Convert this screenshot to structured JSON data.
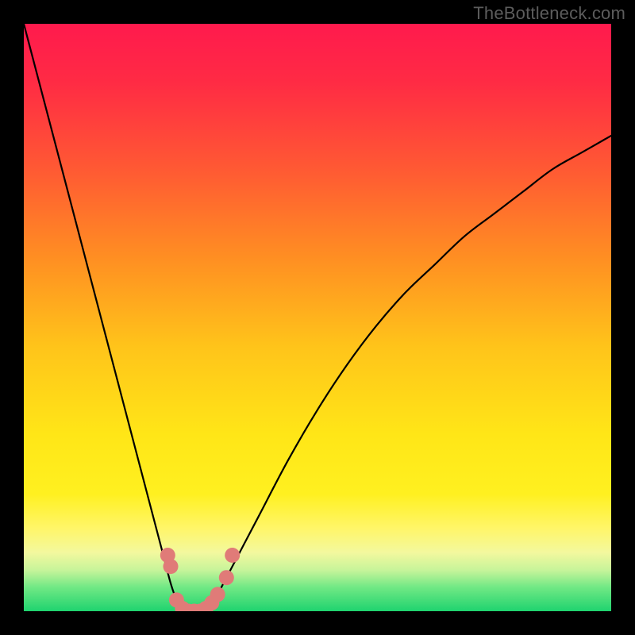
{
  "watermark": "TheBottleneck.com",
  "chart_data": {
    "type": "line",
    "title": "",
    "xlabel": "",
    "ylabel": "",
    "xlim": [
      0,
      100
    ],
    "ylim": [
      -5,
      100
    ],
    "series": [
      {
        "name": "bottleneck-curve",
        "x": [
          0,
          2,
          4,
          6,
          8,
          10,
          12,
          14,
          16,
          18,
          20,
          22,
          24,
          25,
          26,
          27,
          28,
          29,
          30,
          31,
          32,
          33,
          34,
          35,
          37,
          40,
          45,
          50,
          55,
          60,
          65,
          70,
          75,
          80,
          85,
          90,
          95,
          100
        ],
        "values": [
          100,
          92,
          84,
          76,
          68,
          60,
          52,
          44,
          36,
          28,
          20,
          12,
          4,
          0,
          -3,
          -5,
          -5,
          -5,
          -5,
          -5,
          -4,
          -2,
          0,
          2,
          6,
          12,
          22,
          31,
          39,
          46,
          52,
          57,
          62,
          66,
          70,
          74,
          77,
          80
        ]
      }
    ],
    "markers": [
      {
        "x": 24.5,
        "y": 5
      },
      {
        "x": 25.0,
        "y": 3
      },
      {
        "x": 26.0,
        "y": -3
      },
      {
        "x": 27.0,
        "y": -4.5
      },
      {
        "x": 28.0,
        "y": -5
      },
      {
        "x": 29.0,
        "y": -5
      },
      {
        "x": 30.0,
        "y": -5
      },
      {
        "x": 31.0,
        "y": -4.5
      },
      {
        "x": 32.0,
        "y": -3.5
      },
      {
        "x": 33.0,
        "y": -2
      },
      {
        "x": 34.5,
        "y": 1
      },
      {
        "x": 35.5,
        "y": 5
      }
    ],
    "gradient_stops": [
      {
        "offset": 0.0,
        "color": "#ff1a4d"
      },
      {
        "offset": 0.1,
        "color": "#ff2b44"
      },
      {
        "offset": 0.25,
        "color": "#ff5a33"
      },
      {
        "offset": 0.4,
        "color": "#ff8f22"
      },
      {
        "offset": 0.55,
        "color": "#ffc41a"
      },
      {
        "offset": 0.7,
        "color": "#ffe617"
      },
      {
        "offset": 0.8,
        "color": "#fff020"
      },
      {
        "offset": 0.86,
        "color": "#fff66a"
      },
      {
        "offset": 0.9,
        "color": "#f3f89e"
      },
      {
        "offset": 0.93,
        "color": "#c7f49a"
      },
      {
        "offset": 0.96,
        "color": "#6fe884"
      },
      {
        "offset": 1.0,
        "color": "#1fd36f"
      }
    ],
    "marker_color": "#e07b78",
    "curve_color": "#000000"
  }
}
